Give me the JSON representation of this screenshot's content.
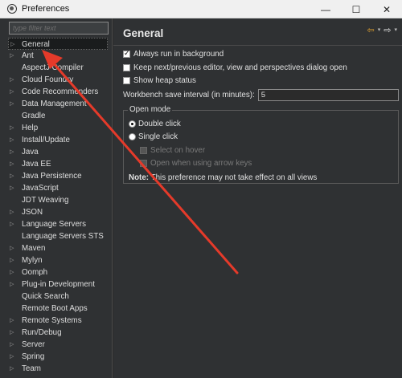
{
  "window": {
    "title": "Preferences",
    "controls": {
      "minimize": "—",
      "maximize": "☐",
      "close": "✕"
    }
  },
  "sidebar": {
    "filter_placeholder": "type filter text",
    "items": [
      {
        "label": "General",
        "expandable": true,
        "selected": true
      },
      {
        "label": "Ant",
        "expandable": true
      },
      {
        "label": "AspectJ Compiler",
        "expandable": false
      },
      {
        "label": "Cloud Foundry",
        "expandable": true
      },
      {
        "label": "Code Recommenders",
        "expandable": true
      },
      {
        "label": "Data Management",
        "expandable": true
      },
      {
        "label": "Gradle",
        "expandable": false
      },
      {
        "label": "Help",
        "expandable": true
      },
      {
        "label": "Install/Update",
        "expandable": true
      },
      {
        "label": "Java",
        "expandable": true
      },
      {
        "label": "Java EE",
        "expandable": true
      },
      {
        "label": "Java Persistence",
        "expandable": true
      },
      {
        "label": "JavaScript",
        "expandable": true
      },
      {
        "label": "JDT Weaving",
        "expandable": false
      },
      {
        "label": "JSON",
        "expandable": true
      },
      {
        "label": "Language Servers",
        "expandable": true
      },
      {
        "label": "Language Servers STS",
        "expandable": false
      },
      {
        "label": "Maven",
        "expandable": true
      },
      {
        "label": "Mylyn",
        "expandable": true
      },
      {
        "label": "Oomph",
        "expandable": true
      },
      {
        "label": "Plug-in Development",
        "expandable": true
      },
      {
        "label": "Quick Search",
        "expandable": false
      },
      {
        "label": "Remote Boot Apps",
        "expandable": false
      },
      {
        "label": "Remote Systems",
        "expandable": true
      },
      {
        "label": "Run/Debug",
        "expandable": true
      },
      {
        "label": "Server",
        "expandable": true
      },
      {
        "label": "Spring",
        "expandable": true
      },
      {
        "label": "Team",
        "expandable": true
      }
    ]
  },
  "page": {
    "title": "General",
    "nav": {
      "back": "⇦",
      "forward": "⇨",
      "dropdown": "▾",
      "menu": "▾"
    },
    "options": {
      "always_run_background": {
        "label": "Always run in background",
        "checked": true
      },
      "keep_next_prev": {
        "label": "Keep next/previous editor, view and perspectives dialog open",
        "checked": false
      },
      "show_heap": {
        "label": "Show heap status",
        "checked": false
      }
    },
    "save_interval": {
      "label": "Workbench save interval (in minutes):",
      "value": "5"
    },
    "open_mode": {
      "title": "Open mode",
      "double_click": "Double click",
      "single_click": "Single click",
      "selected": "double_click",
      "select_on_hover": "Select on hover",
      "open_arrow_keys": "Open when using arrow keys",
      "note_label": "Note:",
      "note_text": " This preference may not take effect on all views"
    }
  },
  "annotation": {
    "color": "#e53a2a"
  }
}
